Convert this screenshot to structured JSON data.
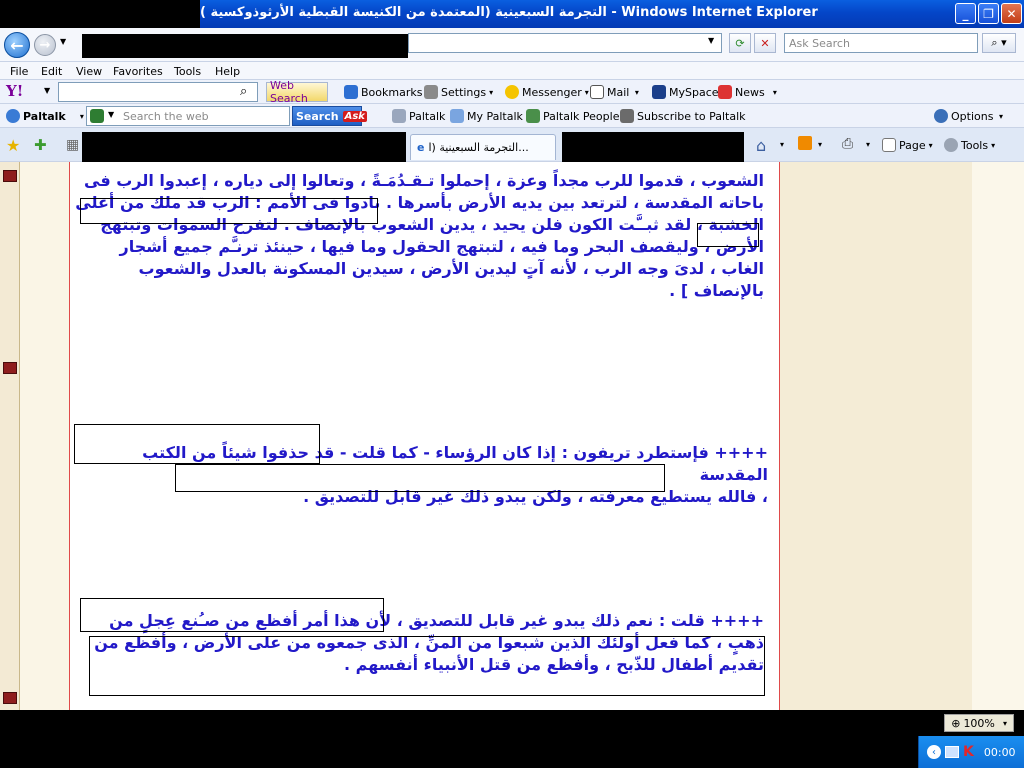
{
  "window": {
    "title": "التجرمة السبعينية (المعتمدة من الكنيسة القبطية الأرثوذوكسية ) - Windows Internet Explorer"
  },
  "address_bar": {
    "search_placeholder": "Ask Search"
  },
  "menu": {
    "items": [
      "File",
      "Edit",
      "View",
      "Favorites",
      "Tools",
      "Help"
    ]
  },
  "yahoo_toolbar": {
    "web_search": "Web Search",
    "bookmarks": "Bookmarks",
    "settings": "Settings",
    "messenger": "Messenger",
    "mail": "Mail",
    "myspace": "MySpace",
    "news": "News"
  },
  "paltalk_toolbar": {
    "brand": "Paltalk",
    "search_placeholder": "Search the web",
    "search_button": "Search",
    "ask_badge": "Ask",
    "items": [
      "Paltalk",
      "My Paltalk",
      "Paltalk People",
      "Subscribe to Paltalk"
    ],
    "options": "Options"
  },
  "tabs": {
    "active_tab": "التجرمة السبعينية (ا...",
    "page_label": "Page",
    "tools_label": "Tools"
  },
  "content": {
    "paragraph1": [
      "الشعوب ، قدموا للرب مجداً وعزة ، إحملوا تـقـدُمَـةً ، وتعالوا إلى دياره ، إعبدوا الرب فى",
      "باحاته المقدسة ، لترتعد بين يديه الأرض بأسرها . نادوا فى الأمم : الرب قد ملك من أعلى",
      "الخشبة ، لقد ثبــَّت الكون فلن يحيد ، يدين الشعوب بالإنصاف . لتفرح السموات وتبتهج",
      "الأرض ، وليقصف البحر وما فيه ، لتبتهج الحقول وما فيها ، حينئذ ترنـَّم جميع أشجار",
      "الغاب ، لدىَ وجه الرب ، لأنه آتٍ ليدين الأرض ، سيدين المسكونة بالعدل والشعوب",
      "بالإنصاف ] ."
    ],
    "paragraph2": [
      "++++ فإستطرد تريفون : إذا كان الرؤساء - كما قلت - قد حذفوا شيئاً من الكتب المقدسة",
      "، فالله يستطيع معرفته ، ولكن يبدو ذلك غير قابل للتصديق ."
    ],
    "paragraph3": [
      "++++ قلت : نعم ذلك يبدو غير قابل للتصديق ، لأن هذا أمر أفظع من صـُنع عِجلٍ من",
      "ذهبٍ ، كما فعل أولئك الذين شبعوا من المنِّ ، الذى جمعوه من على الأرض ، وأفظع من",
      "تقديم أطفال للذّبح ، وأفظع من قتل الأنبياء أنفسهم ."
    ]
  },
  "status_bar": {
    "zoom": "100%"
  },
  "taskbar": {
    "clock": "00:00"
  }
}
